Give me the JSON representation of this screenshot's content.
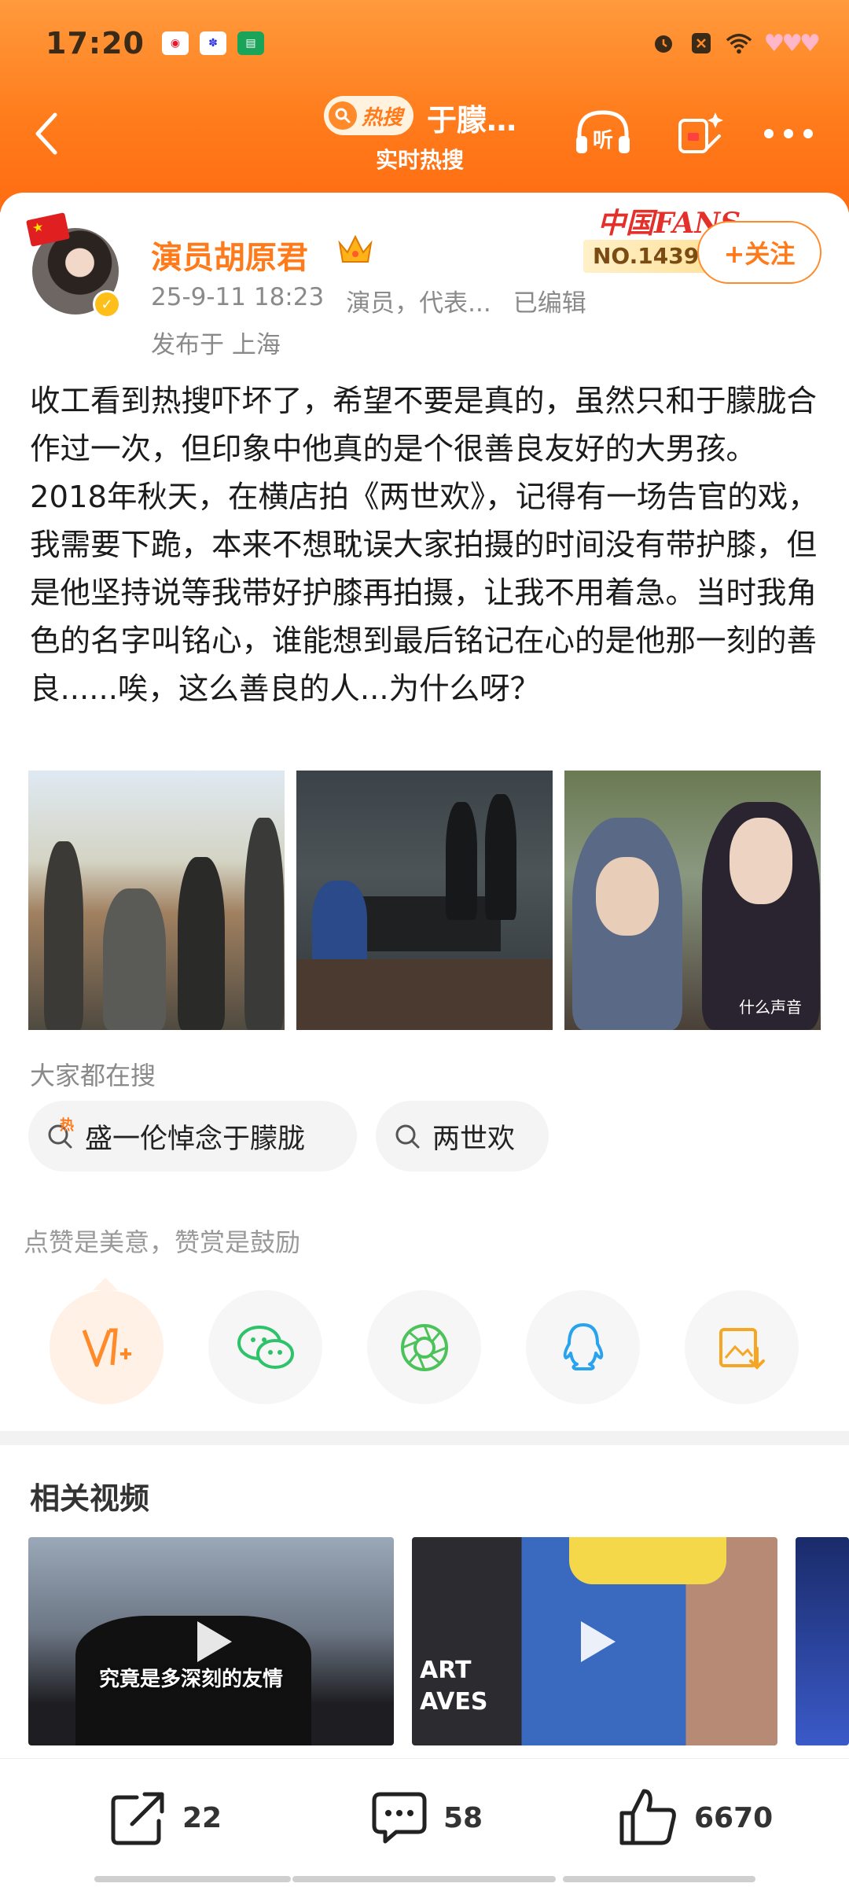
{
  "status_bar": {
    "time": "17:20",
    "apps": [
      "weibo-icon",
      "baidu-icon",
      "news-icon"
    ],
    "right_icons": [
      "alarm-icon",
      "blocked-icon",
      "wifi-icon",
      "hearts-icon"
    ]
  },
  "nav": {
    "hot_tag": "热搜",
    "title": "于朦…",
    "subtitle": "实时热搜",
    "listen_label": "听"
  },
  "author": {
    "name": "演员胡原君",
    "meta_time": "25-9-11 18:23",
    "meta_role": "演员，代表...",
    "meta_edited": "已编辑",
    "location": "发布于 上海",
    "fans_badge_title": "中国FANS",
    "fans_badge_no": "NO.143971",
    "follow_label": "+关注"
  },
  "post": {
    "text": "收工看到热搜吓坏了，希望不要是真的，虽然只和于朦胧合作过一次，但印象中他真的是个很善良友好的大男孩。2018年秋天，在横店拍《两世欢》，记得有一场告官的戏，我需要下跪，本来不想耽误大家拍摄的时间没有带护膝，但是他坚持说等我带好护膝再拍摄，让我不用着急。当时我角色的名字叫铭心，谁能想到最后铭记在心的是他那一刻的善良......唉，这么善良的人...为什么呀？",
    "photo_caption": "什么声音"
  },
  "searches": {
    "title": "大家都在搜",
    "items": [
      {
        "label": "盛一伦悼念于朦胧",
        "hot_mark": "热"
      },
      {
        "label": "两世欢"
      }
    ]
  },
  "share": {
    "encourage_text": "点赞是美意，赞赏是鼓励",
    "buttons": [
      "vplus-icon",
      "wechat-icon",
      "moments-icon",
      "qq-icon",
      "save-image-icon"
    ]
  },
  "related": {
    "title": "相关视频",
    "videos": [
      {
        "caption": "究竟是多深刻的友情"
      },
      {
        "caption": "ART\nAVES"
      },
      {
        "caption": ""
      }
    ]
  },
  "actions": {
    "share_count": "22",
    "comment_count": "58",
    "like_count": "6670"
  },
  "colors": {
    "accent": "#ff7a1a",
    "header_gradient_top": "#ff9a3c",
    "header_gradient_bottom": "#ff6c12"
  }
}
